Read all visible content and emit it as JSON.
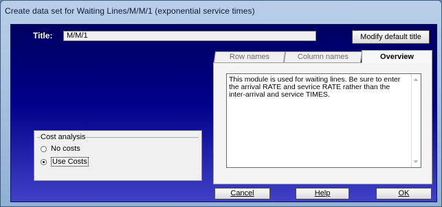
{
  "window": {
    "title": "Create data set for Waiting Lines/M/M/1  (exponential service times)"
  },
  "form": {
    "title_label": "Title:",
    "title_value": "M/M/1",
    "modify_button": "Modify default title"
  },
  "tabs": {
    "items": [
      {
        "label": "Row names",
        "active": false
      },
      {
        "label": "Column names",
        "active": false
      },
      {
        "label": "Overview",
        "active": true
      }
    ],
    "overview_text": "This module is used for waiting lines. Be sure to enter the arrival RATE and sevrice RATE rather than the inter-arrival and service TIMES."
  },
  "cost_analysis": {
    "legend": "Cost analysis",
    "options": [
      {
        "label": "No costs",
        "selected": false
      },
      {
        "label": "Use Costs",
        "selected": true
      }
    ]
  },
  "buttons": {
    "cancel": "Cancel",
    "help": "Help",
    "ok": "OK"
  },
  "colors": {
    "client_top": "#000060",
    "client_bottom": "#4040c8",
    "frame": "#b9cfe9"
  }
}
